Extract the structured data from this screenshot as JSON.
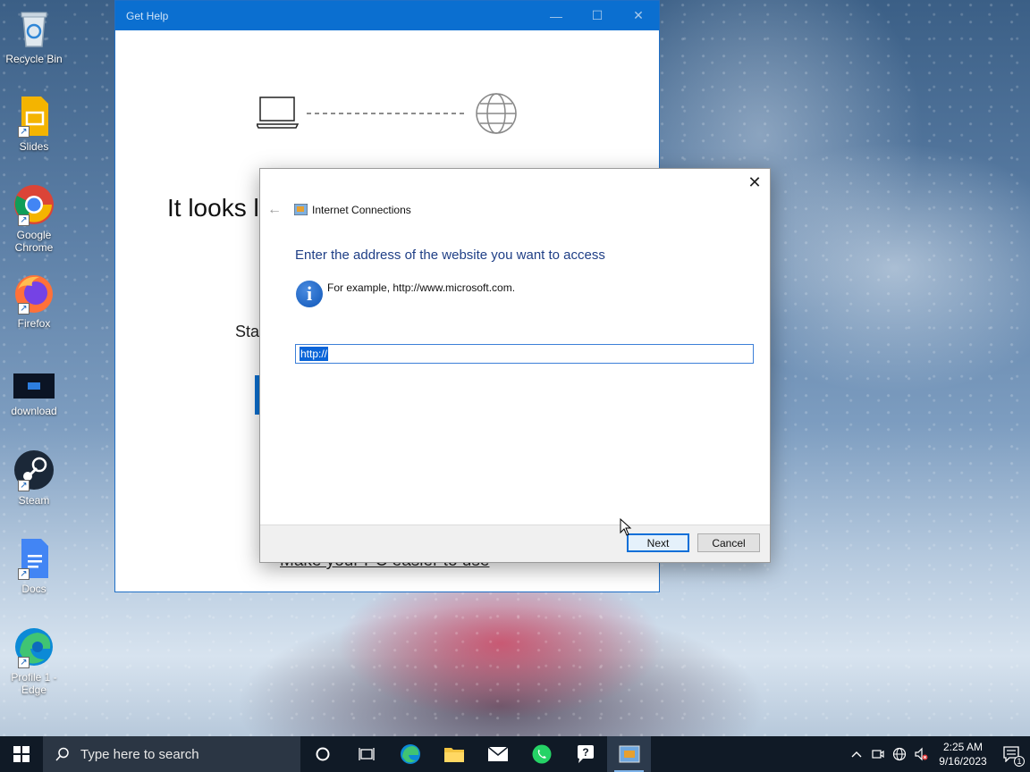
{
  "desktop": {
    "icons": [
      {
        "label": "Recycle Bin"
      },
      {
        "label": "Slides"
      },
      {
        "label": "Google Chrome"
      },
      {
        "label": "Firefox"
      },
      {
        "label": "download"
      },
      {
        "label": "Steam"
      },
      {
        "label": "Docs"
      },
      {
        "label": "Profile 1 - Edge"
      }
    ]
  },
  "get_help": {
    "title": "Get Help",
    "headline": "It looks l",
    "sub": "Sta",
    "link": "Make your PC easier to use",
    "controls": {
      "minimize": "—",
      "maximize": "☐",
      "close": "✕"
    }
  },
  "dialog": {
    "title": "Internet Connections",
    "heading": "Enter the address of the website you want to access",
    "example": "For example, http://www.microsoft.com.",
    "url_value": "http://",
    "next_label": "Next",
    "cancel_label": "Cancel",
    "colors": {
      "heading": "#1f3f86",
      "accent": "#0a6fd8"
    }
  },
  "taskbar": {
    "search_placeholder": "Type here to search",
    "time": "2:25 AM",
    "date": "9/16/2023",
    "notification_count": "1",
    "apps": [
      "cortana-icon",
      "task-view-icon",
      "edge-icon",
      "file-explorer-icon",
      "mail-icon",
      "whatsapp-icon",
      "help-icon",
      "internet-connections-icon"
    ]
  }
}
